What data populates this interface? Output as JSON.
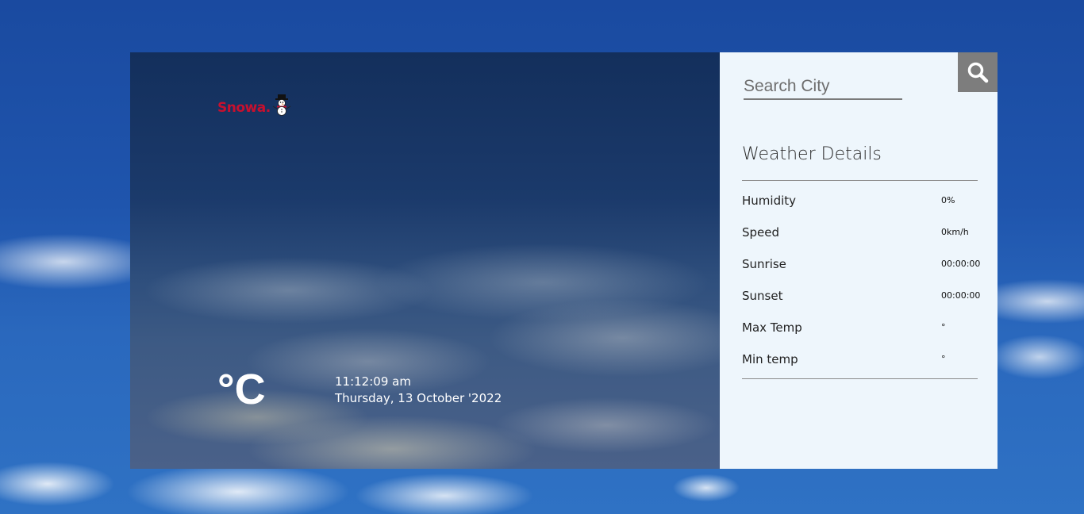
{
  "app": {
    "logo_text": "Snowa."
  },
  "weather": {
    "temperature": "°C",
    "time": "11:12:09 am",
    "date": "Thursday, 13 October '2022"
  },
  "search": {
    "placeholder": "Search City"
  },
  "details": {
    "title": "Weather Details",
    "items": [
      {
        "label": "Humidity",
        "value": "0%"
      },
      {
        "label": "Speed",
        "value": "0km/h"
      },
      {
        "label": "Sunrise",
        "value": "00:00:00"
      },
      {
        "label": "Sunset",
        "value": "00:00:00"
      },
      {
        "label": "Max Temp",
        "value": "°"
      },
      {
        "label": "Min temp",
        "value": "°"
      }
    ]
  },
  "colors": {
    "brand": "#c8102e",
    "panel_bg": "#eef6fc",
    "search_button_bg": "#7d7d7d"
  },
  "icons": {
    "search": "search-icon",
    "logo": "snowman-icon"
  }
}
